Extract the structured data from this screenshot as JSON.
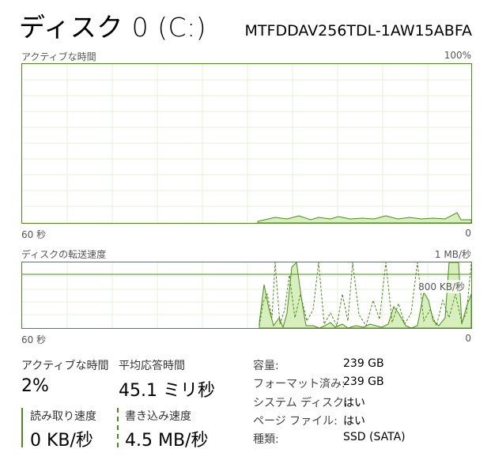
{
  "header": {
    "title": "ディスク 0 (C:)",
    "model": "MTFDDAV256TDL-1AW15ABFA"
  },
  "active_chart": {
    "label": "アクティブな時間",
    "max_label": "100%",
    "time_label": "60 秒",
    "min_label": "0"
  },
  "transfer_chart": {
    "label": "ディスクの転送速度",
    "max_label": "1 MB/秒",
    "time_label": "60 秒",
    "min_label": "0",
    "marker_label": "800 KB/秒"
  },
  "stats": {
    "active_time_label": "アクティブな時間",
    "active_time_value": "2%",
    "avg_response_label": "平均応答時間",
    "avg_response_value": "45.1 ミリ秒",
    "read_speed_label": "読み取り速度",
    "read_speed_value": "0 KB/秒",
    "write_speed_label": "書き込み速度",
    "write_speed_value": "4.5 MB/秒"
  },
  "info": [
    {
      "label": "容量:",
      "value": "239 GB"
    },
    {
      "label": "フォーマット済み:",
      "value": "239 GB"
    },
    {
      "label": "システム ディスク:",
      "value": "はい"
    },
    {
      "label": "ページ ファイル:",
      "value": "はい"
    },
    {
      "label": "種類:",
      "value": "SSD (SATA)"
    }
  ],
  "colors": {
    "line": "#4d8a1c",
    "fill": "#d7efbd",
    "grid": "#e6f0dc"
  }
}
